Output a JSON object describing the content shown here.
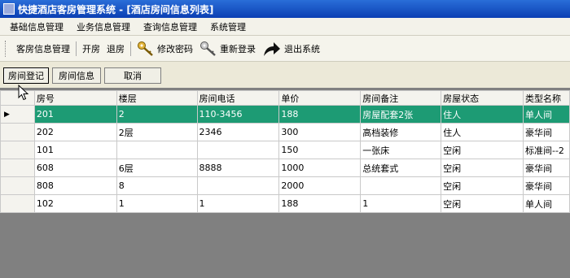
{
  "window": {
    "title": "快捷酒店客房管理系统 - [酒店房间信息列表]"
  },
  "menubar": {
    "items": [
      "基础信息管理",
      "业务信息管理",
      "查询信息管理",
      "系统管理"
    ]
  },
  "toolbar": {
    "items": [
      "客房信息管理",
      "开房",
      "退房",
      "修改密码",
      "重新登录",
      "退出系统"
    ]
  },
  "actions": {
    "buttons": [
      "房间登记",
      "房间信息",
      "取消"
    ]
  },
  "table": {
    "headers": [
      "房号",
      "楼层",
      "房间电话",
      "单价",
      "房间备注",
      "房屋状态",
      "类型名称"
    ],
    "rows": [
      [
        "201",
        "2",
        "110-3456",
        "188",
        "房屋配套2张",
        "住人",
        "单人间"
      ],
      [
        "202",
        "2层",
        "2346",
        "300",
        "高档装修",
        "住人",
        "豪华间"
      ],
      [
        "101",
        "",
        "",
        "150",
        "一张床",
        "空闲",
        "标准间--2"
      ],
      [
        "608",
        "6层",
        "8888",
        "1000",
        "总统套式",
        "空闲",
        "豪华间"
      ],
      [
        "808",
        "8",
        "",
        "2000",
        "",
        "空闲",
        "豪华间"
      ],
      [
        "102",
        "1",
        "1",
        "188",
        "1",
        "空闲",
        "单人间"
      ]
    ],
    "selected_row": 0,
    "row_indicator": "▶"
  },
  "colors": {
    "selection": "#1d9b74",
    "title_bar": "#0b3fb3",
    "background": "#808080"
  }
}
